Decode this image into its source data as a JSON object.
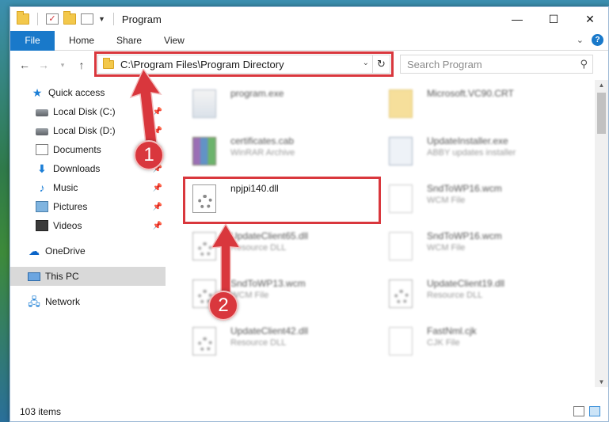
{
  "window": {
    "title": "Program"
  },
  "titlebar": {
    "minimize_glyph": "—",
    "maximize_glyph": "☐",
    "close_glyph": "✕"
  },
  "ribbon": {
    "tabs": [
      "File",
      "Home",
      "Share",
      "View"
    ]
  },
  "nav": {
    "address": "C:\\Program Files\\Program Directory",
    "search_placeholder": "Search Program"
  },
  "sidebar": {
    "items": [
      {
        "label": "Quick access",
        "icon": "star-icon"
      },
      {
        "label": "Local Disk (C:)",
        "icon": "disk-icon"
      },
      {
        "label": "Local Disk (D:)",
        "icon": "disk-icon"
      },
      {
        "label": "Documents",
        "icon": "documents-icon"
      },
      {
        "label": "Downloads",
        "icon": "downloads-icon"
      },
      {
        "label": "Music",
        "icon": "music-icon"
      },
      {
        "label": "Pictures",
        "icon": "pictures-icon"
      },
      {
        "label": "Videos",
        "icon": "videos-icon"
      },
      {
        "label": "OneDrive",
        "icon": "cloud-icon"
      },
      {
        "label": "This PC",
        "icon": "computer-icon"
      },
      {
        "label": "Network",
        "icon": "network-icon"
      }
    ]
  },
  "files": [
    {
      "name": "program.exe",
      "type": ""
    },
    {
      "name": "Microsoft.VC90.CRT",
      "type": ""
    },
    {
      "name": "certificates.cab",
      "type": "WinRAR Archive"
    },
    {
      "name": "UpdateInstaller.exe",
      "type": "ABBY updates installer"
    },
    {
      "name": "npjpi140.dll",
      "type": ""
    },
    {
      "name": "SndToWP16.wcm",
      "type": "WCM File"
    },
    {
      "name": "UpdateClient65.dll",
      "type": "Resource DLL"
    },
    {
      "name": "SndToWP16.wcm",
      "type": "WCM File"
    },
    {
      "name": "SndToWP13.wcm",
      "type": "WCM File"
    },
    {
      "name": "UpdateClient19.dll",
      "type": "Resource DLL"
    },
    {
      "name": "UpdateClient42.dll",
      "type": "Resource DLL"
    },
    {
      "name": "FastNml.cjk",
      "type": "CJK File"
    }
  ],
  "status": {
    "item_count": "103 items"
  },
  "annotations": {
    "step1": "1",
    "step2": "2"
  },
  "colors": {
    "accent": "#1979ca",
    "highlight": "#d9373d"
  }
}
